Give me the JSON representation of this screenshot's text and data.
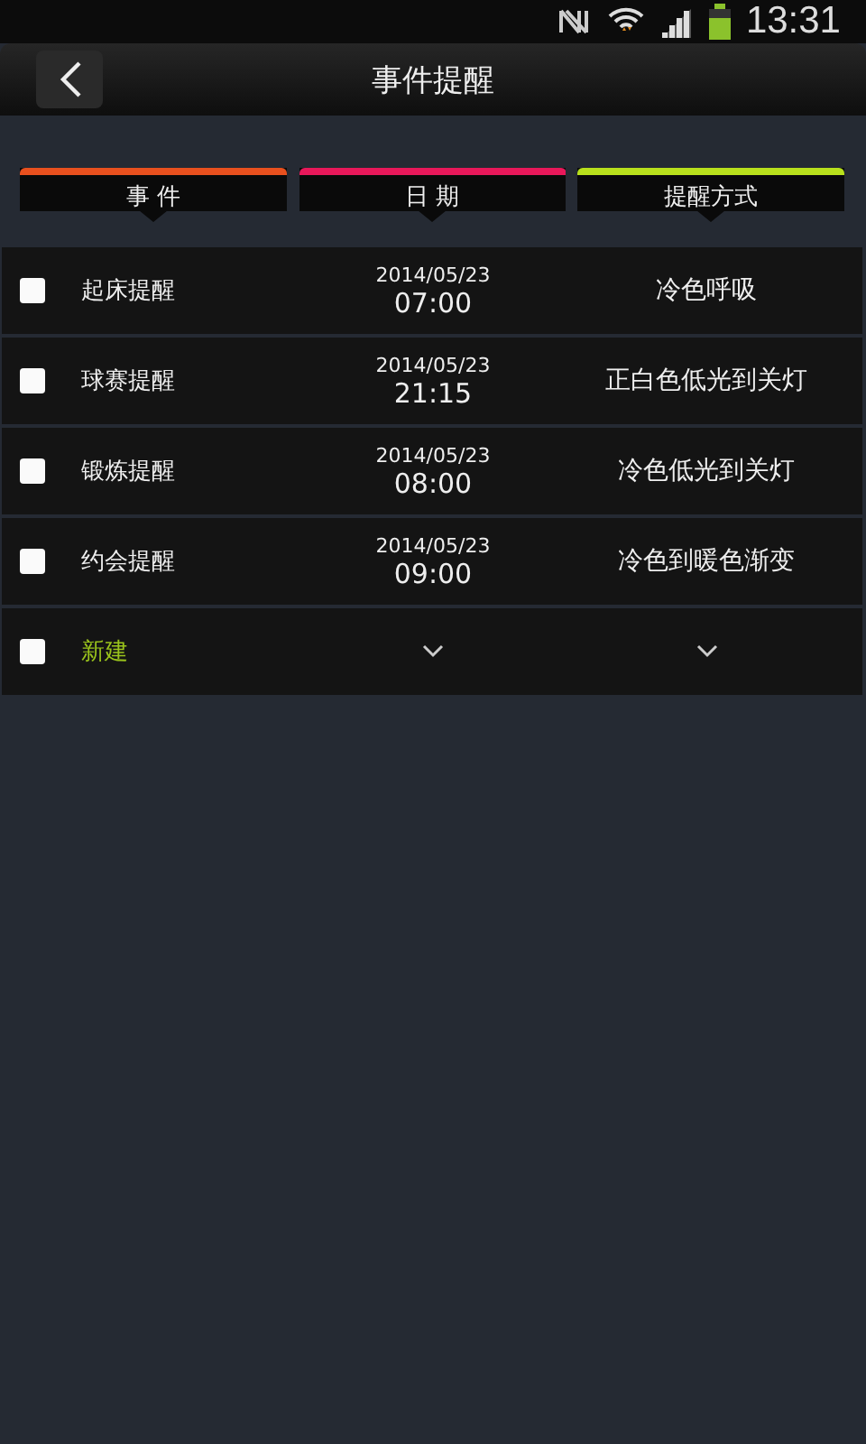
{
  "status_bar": {
    "time": "13:31"
  },
  "window": {
    "title": "事件提醒"
  },
  "columns": [
    {
      "label": "事 件",
      "color": "#e8501e"
    },
    {
      "label": "日 期",
      "color": "#e8185a"
    },
    {
      "label": "提醒方式",
      "color": "#b8e01c"
    }
  ],
  "rows": [
    {
      "kind": "item",
      "checked": false,
      "event": "起床提醒",
      "date": "2014/05/23",
      "time": "07:00",
      "mode": "冷色呼吸"
    },
    {
      "kind": "item",
      "checked": false,
      "event": "球赛提醒",
      "date": "2014/05/23",
      "time": "21:15",
      "mode": "正白色低光到关灯"
    },
    {
      "kind": "item",
      "checked": false,
      "event": "锻炼提醒",
      "date": "2014/05/23",
      "time": "08:00",
      "mode": "冷色低光到关灯"
    },
    {
      "kind": "item",
      "checked": false,
      "event": "约会提醒",
      "date": "2014/05/23",
      "time": "09:00",
      "mode": "冷色到暖色渐变"
    },
    {
      "kind": "new",
      "checked": false,
      "event": "新建"
    }
  ]
}
